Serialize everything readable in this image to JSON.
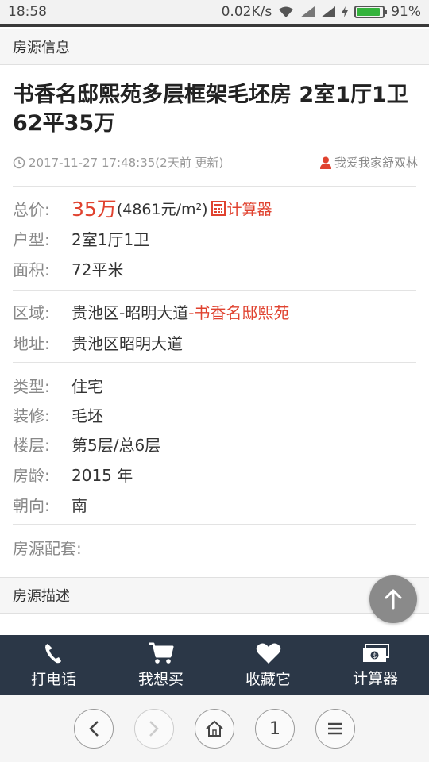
{
  "status_bar": {
    "time": "18:58",
    "network_speed": "0.02K/s",
    "battery": "91%",
    "battery_level": 0.91
  },
  "section_info": {
    "label": "房源信息"
  },
  "listing": {
    "title": "书香名邸熙苑多层框架毛坯房 2室1厅1卫 62平35万",
    "timestamp": "2017-11-27 17:48:35(2天前 更新)",
    "poster": "我爱我家舒双林"
  },
  "details": {
    "price_label": "总价:",
    "price": "35万",
    "price_per_sqm": "(4861元/m²)",
    "calculator_link": "计算器",
    "layout_label": "户型:",
    "layout": "2室1厅1卫",
    "area_label": "面积:",
    "area": "72平米",
    "district_label": "区域:",
    "district": "贵池区-昭明大道",
    "community": "-书香名邸熙苑",
    "address_label": "地址:",
    "address": "贵池区昭明大道",
    "type_label": "类型:",
    "type": "住宅",
    "decoration_label": "装修:",
    "decoration": "毛坯",
    "floor_label": "楼层:",
    "floor": "第5层/总6层",
    "age_label": "房龄:",
    "age": "2015 年",
    "orientation_label": "朝向:",
    "orientation": "南",
    "facilities_label": "房源配套:"
  },
  "section_description": {
    "label": "房源描述"
  },
  "bottom_nav": [
    {
      "label": "打电话",
      "icon": "phone-icon"
    },
    {
      "label": "我想买",
      "icon": "cart-icon"
    },
    {
      "label": "收藏它",
      "icon": "heart-icon"
    },
    {
      "label": "计算器",
      "icon": "money-icon"
    }
  ],
  "browser": {
    "page_number": "1"
  },
  "colors": {
    "accent_red": "#e0422f",
    "nav_bg": "#2b3747",
    "fab_bg": "#8a8a8a"
  }
}
